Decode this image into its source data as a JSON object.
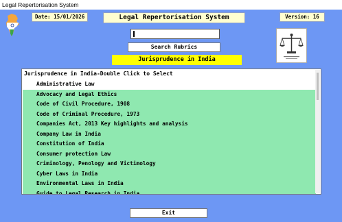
{
  "window": {
    "title": "Legal Repertorisation System"
  },
  "header": {
    "date": "Date: 15/01/2026",
    "app_title": "Legal Repertorisation System",
    "version": "Version: 16"
  },
  "search": {
    "value": "",
    "button_label": "Search Rubrics"
  },
  "section": {
    "title": "Jurisprudence in India"
  },
  "list": {
    "header": "Jurisprudence in India-Double Click to Select",
    "items": [
      "Administrative Law",
      "Advocacy and Legal Ethics",
      "Code of Civil Procedure, 1908",
      "Code of Criminal Procedure, 1973",
      "Companies Act, 2013 Key highlights and analysis",
      "Company Law in India",
      "Constitution of India",
      "Consumer protection Law",
      "Criminology, Penology and Victimology",
      "Cyber Laws in India",
      "Environmental Laws in India",
      "Guide to Legal Research in India"
    ]
  },
  "footer": {
    "exit_label": "Exit"
  },
  "colors": {
    "background": "#6d97f4",
    "label_bg": "#fffed0",
    "highlight": "#ffff00",
    "list_item_bg": "#8fe8b0"
  },
  "icons": {
    "left_logo": "india-map-flag-icon",
    "right_logo": "scales-of-justice-icon"
  }
}
